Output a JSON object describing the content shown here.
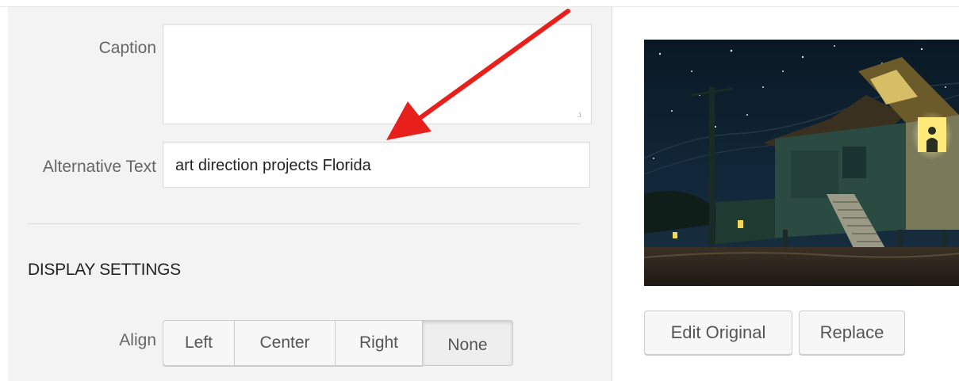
{
  "fields": {
    "caption_label": "Caption",
    "caption_value": "",
    "alt_label": "Alternative Text",
    "alt_value": "art direction projects Florida"
  },
  "display_settings": {
    "heading": "DISPLAY SETTINGS",
    "align_label": "Align",
    "align_options": [
      "Left",
      "Center",
      "Right",
      "None"
    ],
    "align_selected": "None"
  },
  "preview_actions": {
    "edit_original_label": "Edit Original",
    "replace_label": "Replace"
  },
  "annotation": {
    "arrow_color": "#e8201b"
  }
}
